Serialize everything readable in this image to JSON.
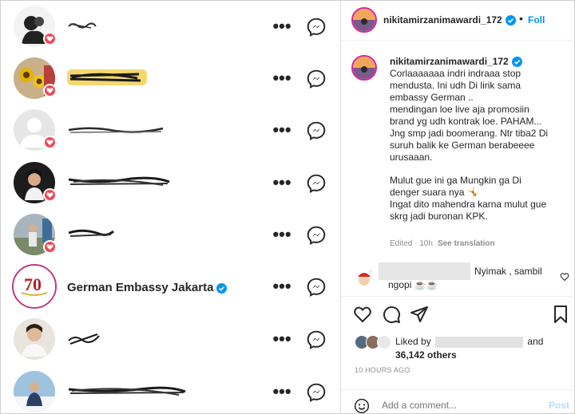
{
  "followers": [
    {
      "name_visible": "",
      "liked": true,
      "verified": false
    },
    {
      "name_visible": "",
      "liked": true,
      "verified": false
    },
    {
      "name_visible": "",
      "liked": true,
      "verified": false
    },
    {
      "name_visible": "",
      "liked": true,
      "verified": false
    },
    {
      "name_visible": "",
      "liked": true,
      "verified": false
    },
    {
      "name_visible": "German Embassy Jakarta",
      "liked": false,
      "verified": true
    },
    {
      "name_visible": "",
      "liked": false,
      "verified": false
    },
    {
      "name_visible": "",
      "liked": false,
      "verified": false
    }
  ],
  "row_more_label": "•••",
  "post": {
    "header_username": "nikitamirzanimawardi_172",
    "header_follow": "Foll",
    "header_dot": "•",
    "caption_username": "nikitamirzanimawardi_172",
    "caption_lines": [
      "Corlaaaaaaa indri indraaa stop",
      "mendusta. Ini udh Di lirik sama",
      "embassy German ..",
      "mendingan loe live aja promosiin",
      "brand yg udh kontrak loe. PAHAM...",
      "Jng smp jadi boomerang. Ntr tiba2 Di",
      "suruh balik ke German berabeeee",
      "urusaaan."
    ],
    "caption_lines_2": [
      "Mulut gue ini ga Mungkin ga Di",
      "denger suara nya 🤸",
      "Ingat dito mahendra karna mulut gue",
      "skrg jadi buronan KPK."
    ],
    "caption_meta_edited": "Edited · 10h",
    "caption_meta_translation": "See translation",
    "comment_text_1": "Nyimak , sambil",
    "comment_text_2": "ngopi ☕☕",
    "liked_by_prefix": "Liked by",
    "liked_by_and": "and",
    "liked_others": "36,142 others",
    "time_ago": "10 HOURS AGO",
    "add_comment_placeholder": "Add a comment...",
    "post_button": "Post"
  },
  "colors": {
    "heart": "#ed4956",
    "verified": "#0095f6",
    "follow": "#0095f6",
    "post_disabled": "#b2dffc"
  },
  "icons": [
    "heart-icon",
    "comment-icon",
    "share-icon",
    "bookmark-icon",
    "messenger-icon",
    "more-icon",
    "verified-icon",
    "emoji-icon"
  ]
}
